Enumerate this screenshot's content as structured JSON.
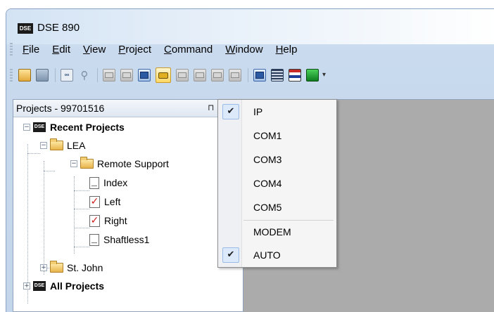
{
  "window": {
    "title": "DSE 890",
    "logo_text": "DSE"
  },
  "menubar": {
    "items": [
      "File",
      "Edit",
      "View",
      "Project",
      "Command",
      "Window",
      "Help"
    ]
  },
  "toolbar": {
    "active_button_icon": "connection-icon",
    "overflow_glyph": "▾"
  },
  "projects_panel": {
    "title": "Projects - 99701516",
    "pin_glyph": "⊓",
    "tree": {
      "recent_projects": {
        "label": "Recent Projects",
        "expander": "−",
        "children": {
          "lea": {
            "label": "LEA",
            "expander": "−",
            "remote_support": {
              "label": "Remote Support",
              "expander": "−",
              "items": [
                {
                  "label": "Index",
                  "icon": "doc-icon"
                },
                {
                  "label": "Left",
                  "icon": "checked-doc-icon",
                  "mark": "✓"
                },
                {
                  "label": "Right",
                  "icon": "checked-doc-icon",
                  "mark": "✓"
                },
                {
                  "label": "Shaftless1",
                  "icon": "doc-icon"
                }
              ]
            }
          },
          "st_john": {
            "label": "St. John",
            "expander": "+"
          }
        }
      },
      "all_projects": {
        "label": "All Projects",
        "expander": "+"
      }
    }
  },
  "dropdown": {
    "check_glyph": "✔",
    "items": [
      {
        "label": "IP",
        "checked": true
      },
      {
        "label": "COM1",
        "checked": false
      },
      {
        "label": "COM3",
        "checked": false
      },
      {
        "label": "COM4",
        "checked": false
      },
      {
        "label": "COM5",
        "checked": false
      },
      {
        "label": "MODEM",
        "checked": false
      },
      {
        "label": "AUTO",
        "checked": true
      }
    ]
  }
}
